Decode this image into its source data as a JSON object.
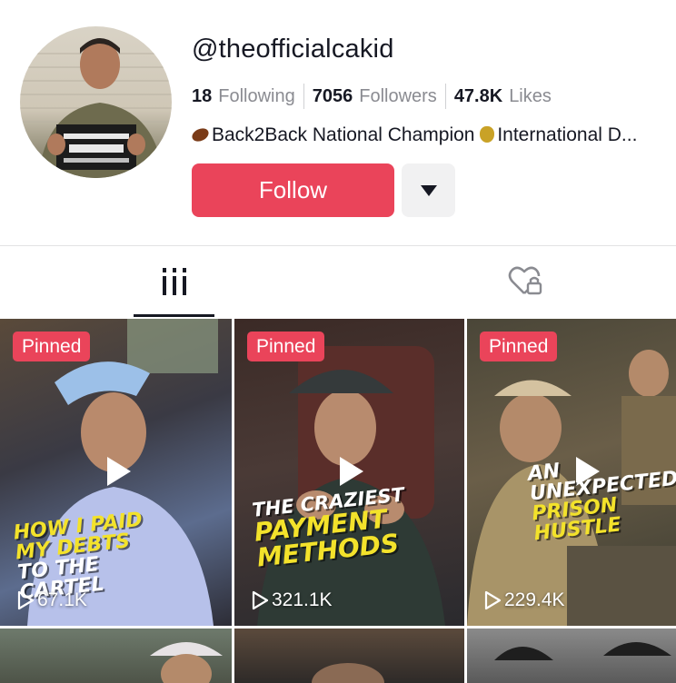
{
  "profile": {
    "handle": "@theofficialcakid",
    "stats": [
      {
        "value": "18",
        "label": "Following"
      },
      {
        "value": "7056",
        "label": "Followers"
      },
      {
        "value": "47.8K",
        "label": "Likes"
      }
    ],
    "bio": {
      "part1": "Back2Back National Champion ",
      "part2": "International D..."
    },
    "follow_label": "Follow",
    "more_icon": "caret-down-icon"
  },
  "tabs": [
    {
      "name": "videos",
      "icon": "grid-icon",
      "active": true
    },
    {
      "name": "liked",
      "icon": "heart-lock-icon",
      "active": false
    }
  ],
  "videos": [
    {
      "badge": "Pinned",
      "views": "67.1K",
      "overlay_lines": [
        "How I paid",
        "my debts",
        "to the",
        "cartel"
      ]
    },
    {
      "badge": "Pinned",
      "views": "321.1K",
      "overlay_lines": [
        "The craziest",
        "payment",
        "methods"
      ]
    },
    {
      "badge": "Pinned",
      "views": "229.4K",
      "overlay_lines": [
        "An",
        "unexpected",
        "prison",
        "hustle"
      ]
    }
  ],
  "colors": {
    "accent": "#ea445a",
    "overlay_yellow": "#f3e22b",
    "muted": "#8a8b91"
  }
}
